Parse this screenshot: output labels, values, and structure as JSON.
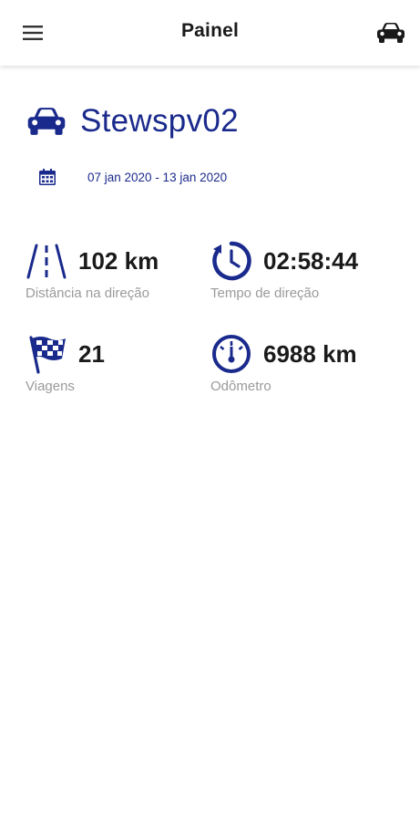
{
  "colors": {
    "accent": "#1a2a8c",
    "text": "#1a1a1a",
    "label": "#9a9a9a",
    "background": "#ffffff"
  },
  "header": {
    "title": "Painel",
    "left_icon": "menu-icon",
    "right_icon": "car-icon"
  },
  "vehicle": {
    "name": "Stewspv02",
    "icon": "car-icon"
  },
  "date_range": {
    "icon": "calendar-icon",
    "text": "07 jan 2020 - 13 jan 2020"
  },
  "stats": [
    {
      "icon": "road-icon",
      "value": "102 km",
      "label": "Distância na direção"
    },
    {
      "icon": "clock-icon",
      "value": "02:58:44",
      "label": "Tempo de direção"
    },
    {
      "icon": "checkered-flag-icon",
      "value": "21",
      "label": "Viagens"
    },
    {
      "icon": "speedometer-icon",
      "value": "6988 km",
      "label": "Odômetro"
    }
  ]
}
